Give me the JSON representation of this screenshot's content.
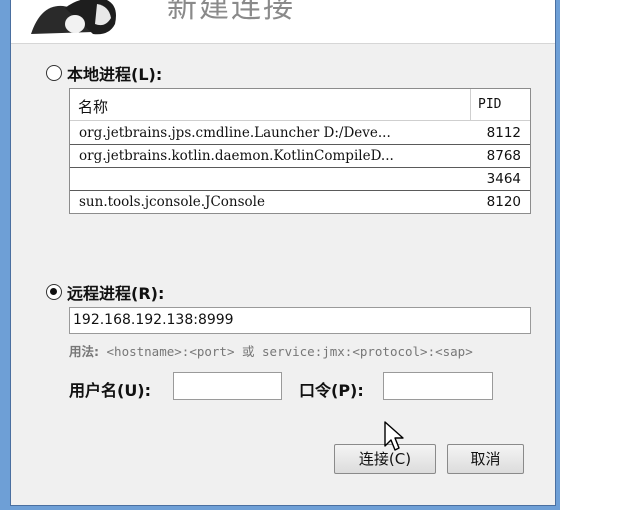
{
  "dialog": {
    "header_title": "新建连接"
  },
  "local": {
    "label": "本地进程(L):",
    "columns": {
      "name": "名称",
      "pid": "PID"
    },
    "rows": [
      {
        "name": "org.jetbrains.jps.cmdline.Launcher D:/Deve...",
        "pid": "8112"
      },
      {
        "name": "org.jetbrains.kotlin.daemon.KotlinCompileD...",
        "pid": "8768"
      },
      {
        "name": "",
        "pid": "3464"
      },
      {
        "name": "sun.tools.jconsole.JConsole",
        "pid": "8120"
      }
    ]
  },
  "remote": {
    "label": "远程进程(R):",
    "host_value": "192.168.192.138:8999",
    "usage_label": "用法:",
    "usage_text": "<hostname>:<port> 或 service:jmx:<protocol>:<sap>",
    "username_label": "用户名(U):",
    "password_label": "口令(P):"
  },
  "buttons": {
    "connect": "连接(C)",
    "cancel": "取消"
  }
}
